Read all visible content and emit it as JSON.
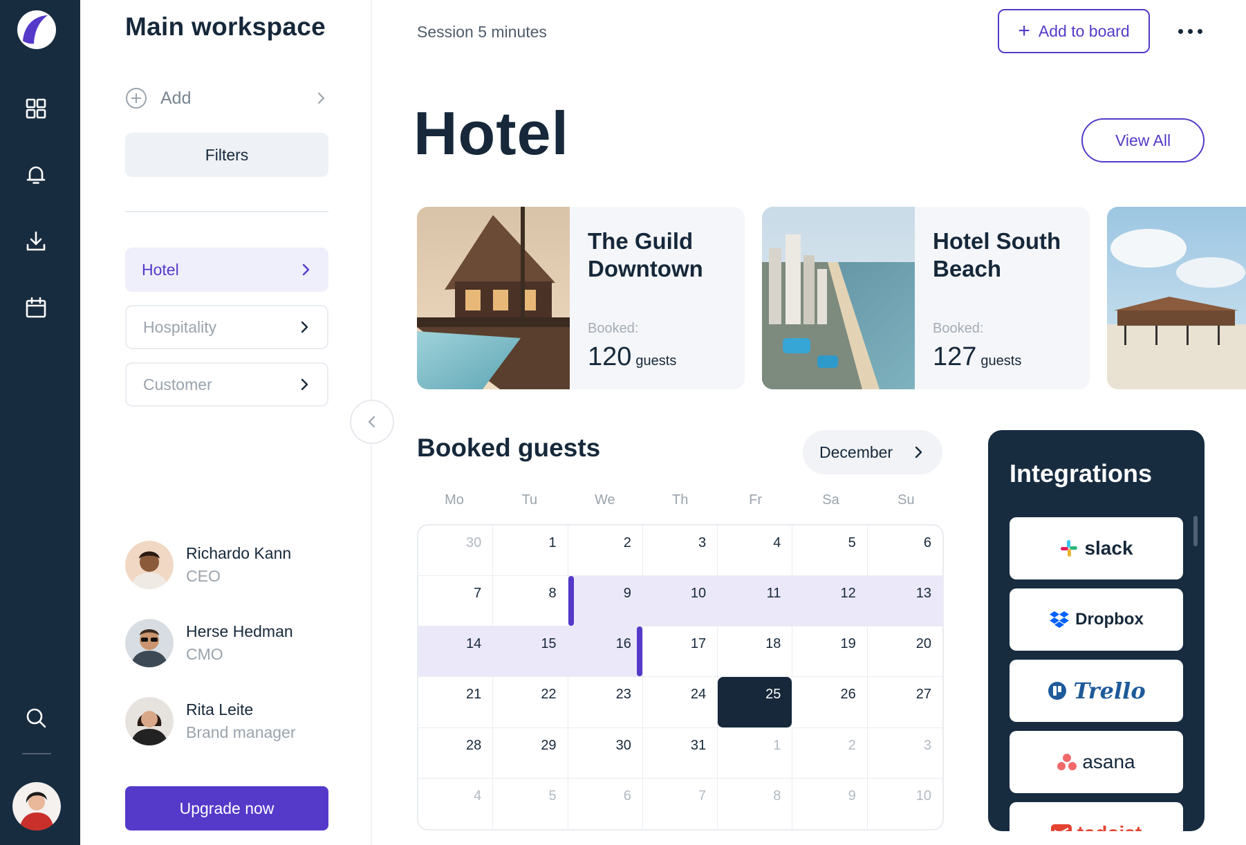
{
  "workspace": {
    "title": "Main workspace",
    "add_label": "Add",
    "filters_label": "Filters",
    "nav": [
      {
        "label": "Hotel",
        "active": true
      },
      {
        "label": "Hospitality",
        "active": false
      },
      {
        "label": "Customer",
        "active": false
      }
    ],
    "people": [
      {
        "name": "Richardo Kann",
        "role": "CEO"
      },
      {
        "name": "Herse Hedman",
        "role": "CMO"
      },
      {
        "name": "Rita Leite",
        "role": "Brand manager"
      }
    ],
    "upgrade_label": "Upgrade now"
  },
  "header": {
    "session": "Session 5 minutes",
    "add_board_icon": "+",
    "add_board_label": "Add to board"
  },
  "page": {
    "title": "Hotel",
    "view_all_label": "View All"
  },
  "hotels": [
    {
      "name": "The Guild Downtown",
      "booked_label": "Booked:",
      "guests": "120",
      "unit": "guests"
    },
    {
      "name": "Hotel South Beach",
      "booked_label": "Booked:",
      "guests": "127",
      "unit": "guests"
    }
  ],
  "calendar": {
    "title": "Booked guests",
    "month": "December",
    "weekdays": [
      "Mo",
      "Tu",
      "We",
      "Th",
      "Fr",
      "Sa",
      "Su"
    ],
    "weeks": [
      [
        "30",
        "1",
        "2",
        "3",
        "4",
        "5",
        "6"
      ],
      [
        "7",
        "8",
        "9",
        "10",
        "11",
        "12",
        "13"
      ],
      [
        "14",
        "15",
        "16",
        "17",
        "18",
        "19",
        "20"
      ],
      [
        "21",
        "22",
        "23",
        "24",
        "25",
        "26",
        "27"
      ],
      [
        "28",
        "29",
        "30",
        "31",
        "1",
        "2",
        "3"
      ],
      [
        "4",
        "5",
        "6",
        "7",
        "8",
        "9",
        "10"
      ]
    ],
    "booked_range": {
      "from": "9",
      "to": "16"
    },
    "today": "25"
  },
  "integrations": {
    "title": "Integrations",
    "items": [
      {
        "label": "slack",
        "icon": "slack-logo-icon"
      },
      {
        "label": "Dropbox",
        "icon": "dropbox-logo-icon"
      },
      {
        "label": "Trello",
        "icon": "trello-logo-icon"
      },
      {
        "label": "asana",
        "icon": "asana-logo-icon"
      },
      {
        "label": "todoist",
        "icon": "todoist-logo-icon"
      }
    ]
  },
  "colors": {
    "sidebar": "#182c40",
    "accent": "#5539c9",
    "range_fill": "#ebe8fa",
    "text": "#16283a",
    "muted": "#9aa3ac"
  }
}
